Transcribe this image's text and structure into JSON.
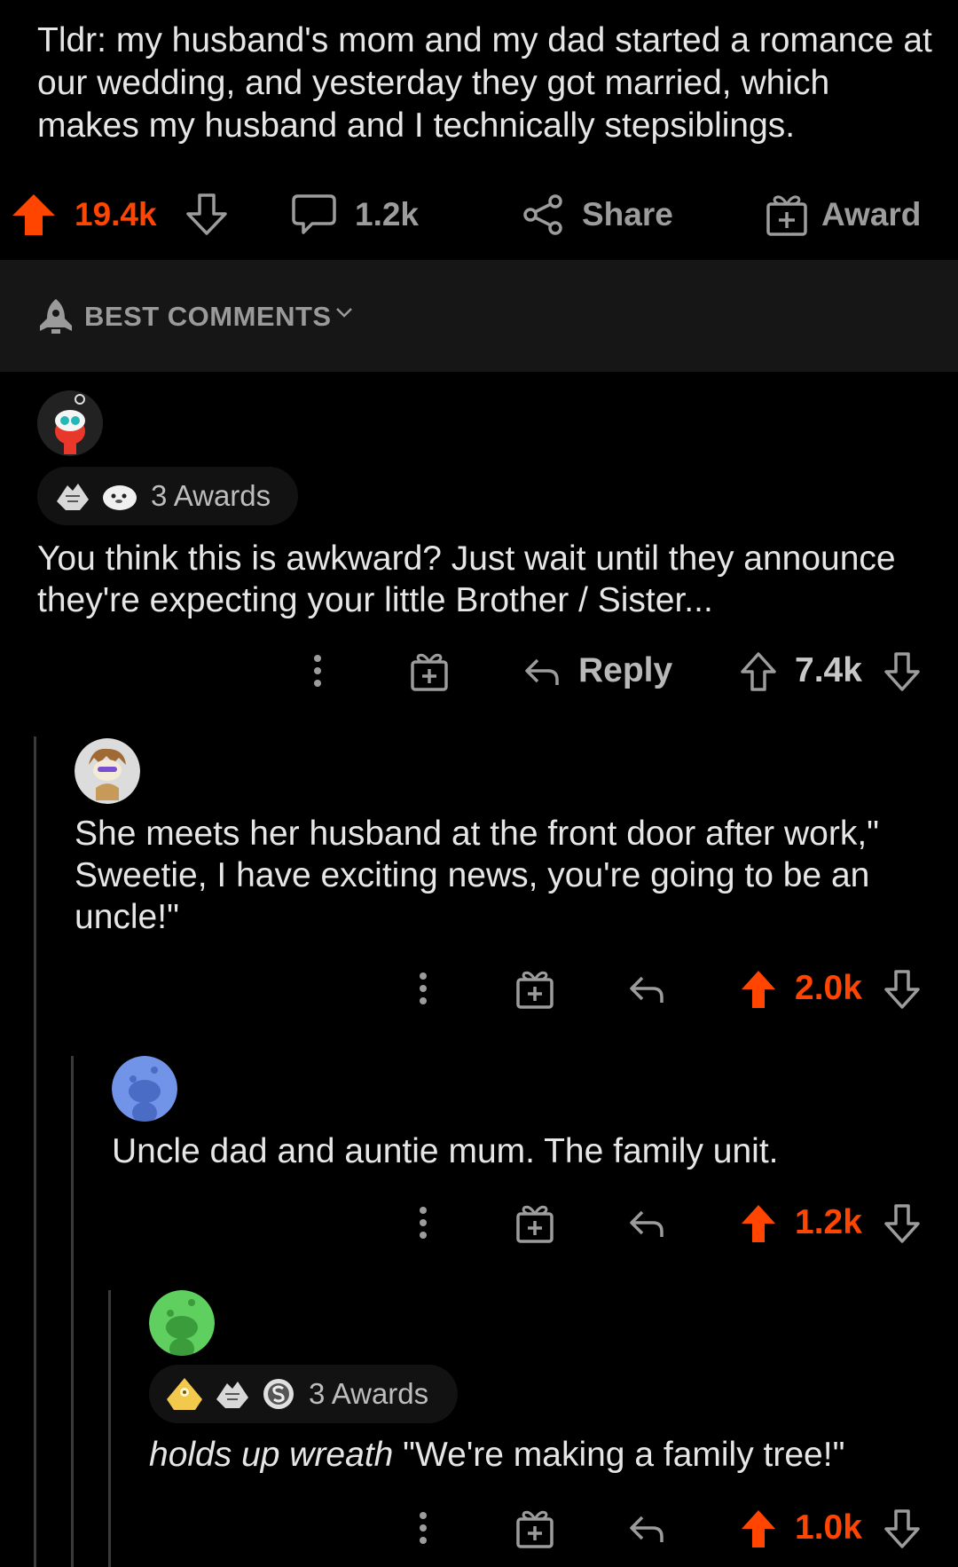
{
  "post": {
    "body": "Tldr: my husband's mom and my dad started a romance at our wedding, and yesterday they got married, which makes my husband and I technically stepsiblings.",
    "score": "19.4k",
    "comments": "1.2k",
    "share_label": "Share",
    "award_label": "Award",
    "upvoted": true
  },
  "sort": {
    "label": "BEST COMMENTS"
  },
  "comments": [
    {
      "awards_text": "3 Awards",
      "body": "You think this is awkward? Just wait until they announce they're expecting your little Brother / Sister...",
      "reply_label": "Reply",
      "score": "7.4k",
      "upvoted": false
    },
    {
      "body": "She meets her husband at the front door after work,\" Sweetie, I have exciting news, you're going to be an uncle!\"",
      "score": "2.0k",
      "upvoted": true
    },
    {
      "body": "Uncle dad and auntie mum. The family unit.",
      "score": "1.2k",
      "upvoted": true
    },
    {
      "awards_text": "3 Awards",
      "body_italic": "holds up wreath",
      "body_rest": " \"We're making a family tree!\"",
      "score": "1.0k",
      "upvoted": true
    }
  ],
  "colors": {
    "accent": "#ff4500",
    "background": "#000000",
    "sort_bar": "#161616",
    "text": "#e6e6e6",
    "muted": "#9c9c9c"
  }
}
